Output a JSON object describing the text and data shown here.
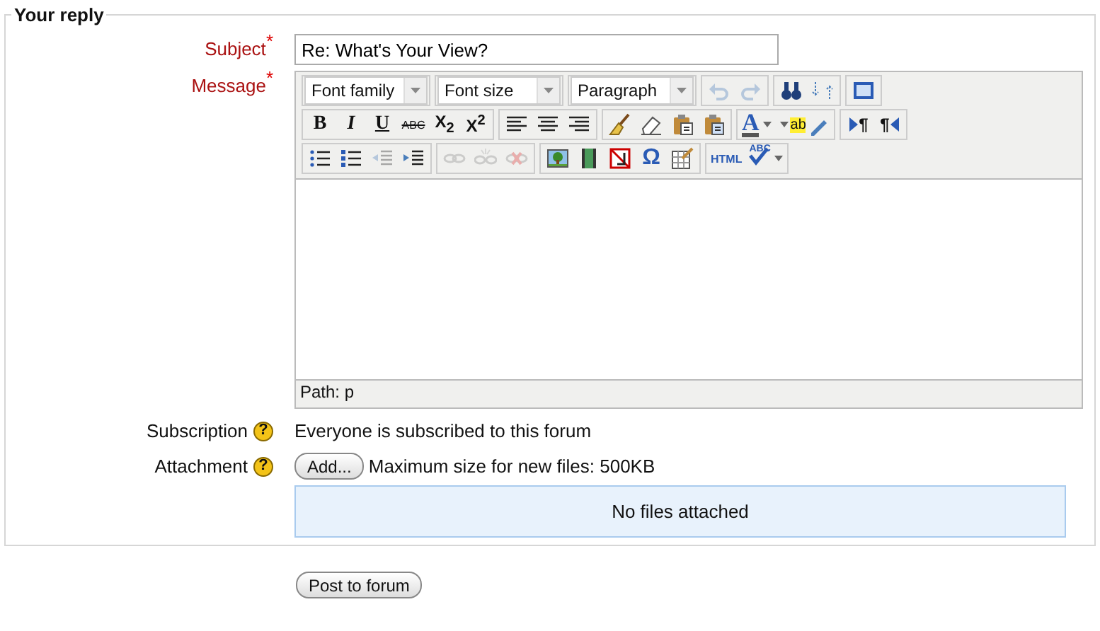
{
  "legend": "Your reply",
  "subject": {
    "label": "Subject",
    "required": "*",
    "value": "Re: What's Your View?"
  },
  "message": {
    "label": "Message",
    "required": "*",
    "path": "Path: p",
    "toolbar": [
      [
        {
          "items": [
            {
              "kind": "select",
              "label": "Font family"
            }
          ]
        },
        {
          "items": [
            {
              "kind": "select",
              "label": "Font size"
            }
          ]
        },
        {
          "items": [
            {
              "kind": "select",
              "label": "Paragraph"
            }
          ]
        },
        {
          "items": [
            {
              "kind": "undo",
              "disabled": true
            },
            {
              "kind": "redo",
              "disabled": true
            }
          ]
        },
        {
          "items": [
            {
              "kind": "find",
              "disabled": false
            },
            {
              "kind": "replace",
              "disabled": false
            }
          ]
        },
        {
          "items": [
            {
              "kind": "fullscreen",
              "disabled": false
            }
          ]
        }
      ],
      [
        {
          "items": [
            {
              "kind": "bold",
              "label": "B",
              "disabled": false
            },
            {
              "kind": "italic",
              "label": "I",
              "disabled": false
            },
            {
              "kind": "underline",
              "label": "U",
              "disabled": false
            },
            {
              "kind": "strike",
              "label": "ABC",
              "disabled": false
            },
            {
              "kind": "sub",
              "label": "X$_{2}$",
              "disabled": false
            },
            {
              "kind": "sup",
              "label": "X$^{2}$",
              "disabled": false
            }
          ]
        },
        {
          "items": [
            {
              "kind": "alignleft",
              "disabled": false
            },
            {
              "kind": "aligncenter",
              "disabled": false
            },
            {
              "kind": "alignright",
              "disabled": false
            }
          ]
        },
        {
          "items": [
            {
              "kind": "cleanup",
              "disabled": false
            },
            {
              "kind": "eraser",
              "disabled": false
            },
            {
              "kind": "pastetext",
              "disabled": false
            },
            {
              "kind": "pasteword",
              "disabled": false
            }
          ]
        },
        {
          "items": [
            {
              "kind": "forecolor",
              "label": "A",
              "disabled": false
            },
            {
              "kind": "backcolor",
              "label": "ab",
              "disabled": false
            }
          ]
        },
        {
          "items": [
            {
              "kind": "ltr",
              "label": "¶",
              "disabled": false
            },
            {
              "kind": "rtl",
              "label": "¶",
              "disabled": false
            }
          ]
        }
      ],
      [
        {
          "items": [
            {
              "kind": "bullets",
              "disabled": false
            },
            {
              "kind": "numbers",
              "disabled": false
            },
            {
              "kind": "outdent",
              "disabled": true
            },
            {
              "kind": "indent",
              "disabled": false
            }
          ]
        },
        {
          "items": [
            {
              "kind": "link",
              "disabled": true
            },
            {
              "kind": "unlink",
              "disabled": true
            },
            {
              "kind": "anchor",
              "disabled": true
            }
          ]
        },
        {
          "items": [
            {
              "kind": "image",
              "disabled": false
            },
            {
              "kind": "media",
              "disabled": false
            },
            {
              "kind": "nolink",
              "disabled": false
            },
            {
              "kind": "charmap",
              "label": "Ω",
              "disabled": false
            },
            {
              "kind": "table",
              "disabled": false
            }
          ]
        },
        {
          "items": [
            {
              "kind": "html",
              "label": "HTML",
              "disabled": false
            },
            {
              "kind": "spell",
              "label": "ABC",
              "disabled": false
            }
          ]
        }
      ]
    ]
  },
  "subscription": {
    "label": "Subscription",
    "help": "?",
    "text": "Everyone is subscribed to this forum"
  },
  "attachment": {
    "label": "Attachment",
    "help": "?",
    "button": "Add...",
    "note": "Maximum size for new files: 500KB",
    "files_text": "No files attached"
  },
  "submit": "Post to forum"
}
